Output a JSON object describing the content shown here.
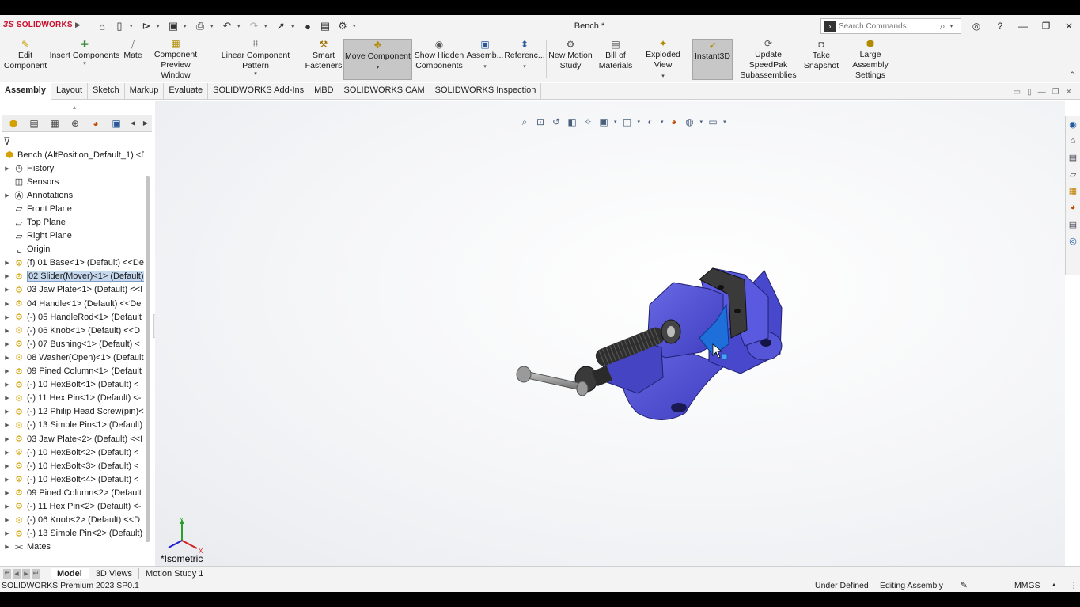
{
  "app": {
    "logo": "SOLIDWORKS",
    "document_title": "Bench *"
  },
  "search": {
    "placeholder": "Search Commands"
  },
  "ribbon": {
    "buttons": [
      {
        "label_1": "Edit",
        "label_2": "Component"
      },
      {
        "label_1": "Insert Components",
        "label_2": ""
      },
      {
        "label_1": "Mate",
        "label_2": ""
      },
      {
        "label_1": "Component",
        "label_2": "Preview Window"
      },
      {
        "label_1": "Linear Component Pattern",
        "label_2": ""
      },
      {
        "label_1": "Smart",
        "label_2": "Fasteners"
      },
      {
        "label_1": "Move Component",
        "label_2": ""
      },
      {
        "label_1": "Show Hidden",
        "label_2": "Components"
      },
      {
        "label_1": "Assemb...",
        "label_2": ""
      },
      {
        "label_1": "Referenc...",
        "label_2": ""
      },
      {
        "label_1": "New Motion",
        "label_2": "Study"
      },
      {
        "label_1": "Bill of",
        "label_2": "Materials"
      },
      {
        "label_1": "Exploded View",
        "label_2": ""
      },
      {
        "label_1": "Instant3D",
        "label_2": ""
      },
      {
        "label_1": "Update SpeedPak",
        "label_2": "Subassemblies"
      },
      {
        "label_1": "Take",
        "label_2": "Snapshot"
      },
      {
        "label_1": "Large Assembly",
        "label_2": "Settings"
      }
    ]
  },
  "tabs": [
    "Assembly",
    "Layout",
    "Sketch",
    "Markup",
    "Evaluate",
    "SOLIDWORKS Add-Ins",
    "MBD",
    "SOLIDWORKS CAM",
    "SOLIDWORKS Inspection"
  ],
  "tree": {
    "root": "Bench (AltPosition_Default_1) <Di",
    "items": [
      "History",
      "Sensors",
      "Annotations",
      "Front Plane",
      "Top Plane",
      "Right Plane",
      "Origin",
      "(f) 01 Base<1> (Default) <<De",
      "02 Slider(Mover)<1> (Default)",
      "03 Jaw Plate<1> (Default) <<I",
      "04 Handle<1> (Default) <<De",
      "(-) 05 HandleRod<1> (Default",
      "(-) 06 Knob<1> (Default) <<D",
      "(-) 07 Bushing<1> (Default) <",
      "08 Washer(Open)<1> (Default",
      "09 Pined Column<1> (Default",
      "(-) 10 HexBolt<1> (Default) <",
      "(-) 11 Hex Pin<1> (Default) <-",
      "(-) 12 Philip Head Screw(pin)<",
      "(-) 13 Simple Pin<1> (Default)",
      "03 Jaw Plate<2> (Default) <<I",
      "(-) 10 HexBolt<2> (Default) <",
      "(-) 10 HexBolt<3> (Default) <",
      "(-) 10 HexBolt<4> (Default) <",
      "09 Pined Column<2> (Default",
      "(-) 11 Hex Pin<2> (Default) <-",
      "(-) 06 Knob<2> (Default) <<D",
      "(-) 13 Simple Pin<2> (Default)",
      "Mates"
    ]
  },
  "viewport": {
    "view_label": "*Isometric"
  },
  "bottom_tabs": [
    "Model",
    "3D Views",
    "Motion Study 1"
  ],
  "status": {
    "product": "SOLIDWORKS Premium 2023 SP0.1",
    "definition": "Under Defined",
    "mode": "Editing Assembly",
    "units": "MMGS"
  },
  "colors": {
    "model_body": "#5050d0",
    "selected_face": "#1e6fd9",
    "brand": "#c8102e"
  }
}
